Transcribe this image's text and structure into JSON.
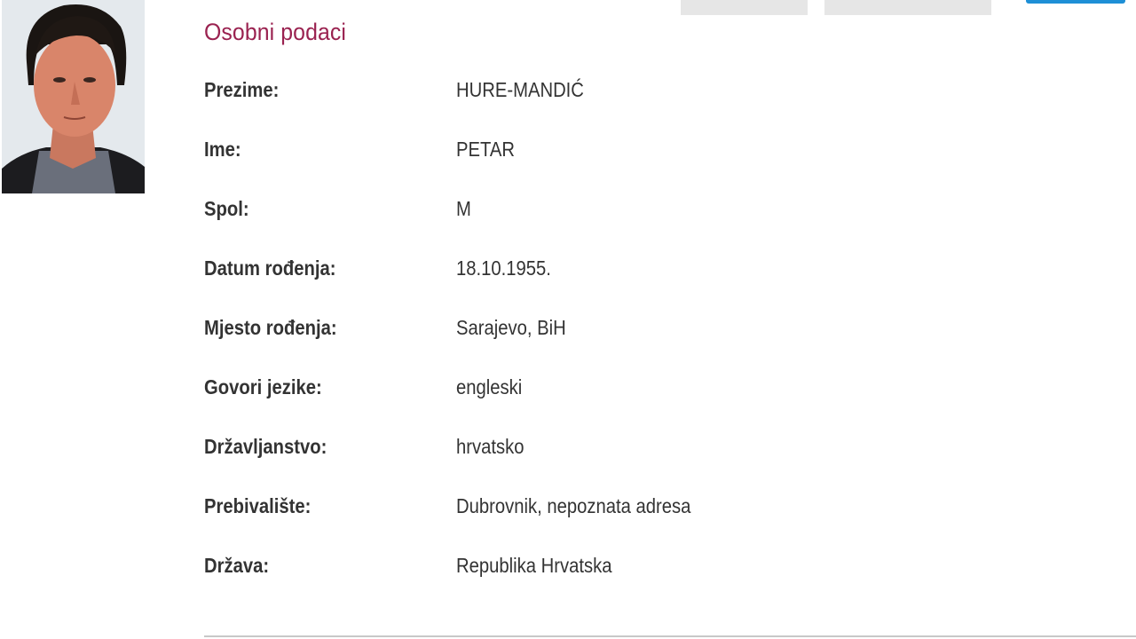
{
  "section": {
    "title": "Osobni podaci"
  },
  "fields": [
    {
      "label": "Prezime:",
      "value": "HURE-MANDIĆ"
    },
    {
      "label": "Ime:",
      "value": "PETAR"
    },
    {
      "label": "Spol:",
      "value": "M"
    },
    {
      "label": "Datum rođenja:",
      "value": "18.10.1955."
    },
    {
      "label": "Mjesto rođenja:",
      "value": "Sarajevo, BiH"
    },
    {
      "label": "Govori jezike:",
      "value": "engleski"
    },
    {
      "label": "Državljanstvo:",
      "value": "hrvatsko"
    },
    {
      "label": "Prebivalište:",
      "value": "Dubrovnik, nepoznata adresa"
    },
    {
      "label": "Država:",
      "value": "Republika Hrvatska"
    }
  ],
  "colors": {
    "title": "#9a2250",
    "text": "#333333",
    "accent_blue": "#1e8fd6",
    "tab_gray": "#e6e6e6"
  }
}
